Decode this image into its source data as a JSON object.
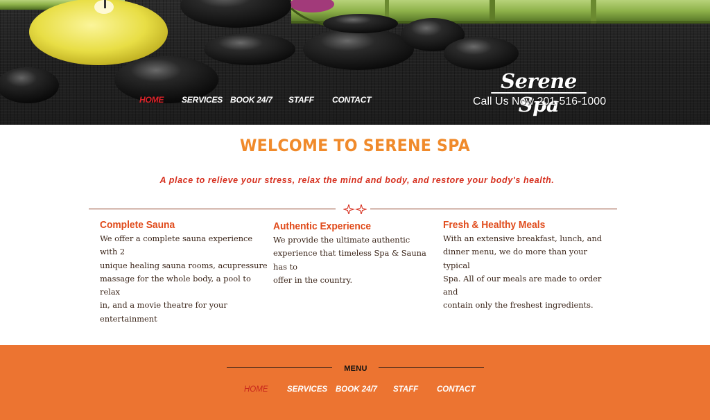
{
  "header": {
    "brand": "Serene Spa",
    "phone_text": "Call Us Now 201-516-1000",
    "nav": [
      {
        "label": "HOME",
        "active": true
      },
      {
        "label": "SERVICES",
        "active": false
      },
      {
        "label": "BOOK 24/7",
        "active": false
      },
      {
        "label": "STAFF",
        "active": false
      },
      {
        "label": "CONTACT",
        "active": false
      }
    ]
  },
  "main": {
    "title": "WELCOME TO SERENE SPA",
    "tagline": "A place to relieve your stress, relax the mind and body, and restore your body's health.",
    "features": [
      {
        "heading": "Complete Sauna",
        "lines": [
          "We offer a complete sauna experience with 2",
          "unique healing sauna rooms, acupressure",
          "massage for the whole body, a pool to relax",
          "in, and a movie theatre for your",
          "entertainment"
        ]
      },
      {
        "heading": "Authentic Experience",
        "lines": [
          "We provide the ultimate authentic",
          "experience that timeless Spa & Sauna has to",
          "offer in the country."
        ]
      },
      {
        "heading": "Fresh & Healthy Meals",
        "lines": [
          "With an extensive breakfast, lunch, and",
          "dinner menu, we do more than your typical",
          "Spa. All of our meals are made to order and",
          "contain only the freshest ingredients."
        ]
      }
    ]
  },
  "footer": {
    "menu_label": "MENU",
    "nav": [
      {
        "label": "HOME",
        "active": true
      },
      {
        "label": "SERVICES",
        "active": false
      },
      {
        "label": "BOOK 24/7",
        "active": false
      },
      {
        "label": "STAFF",
        "active": false
      },
      {
        "label": "CONTACT",
        "active": false
      }
    ]
  },
  "colors": {
    "accent_orange": "#f08a2b",
    "footer_orange": "#ec7431",
    "active_red": "#e0242b",
    "heading_red": "#e04a1a"
  }
}
